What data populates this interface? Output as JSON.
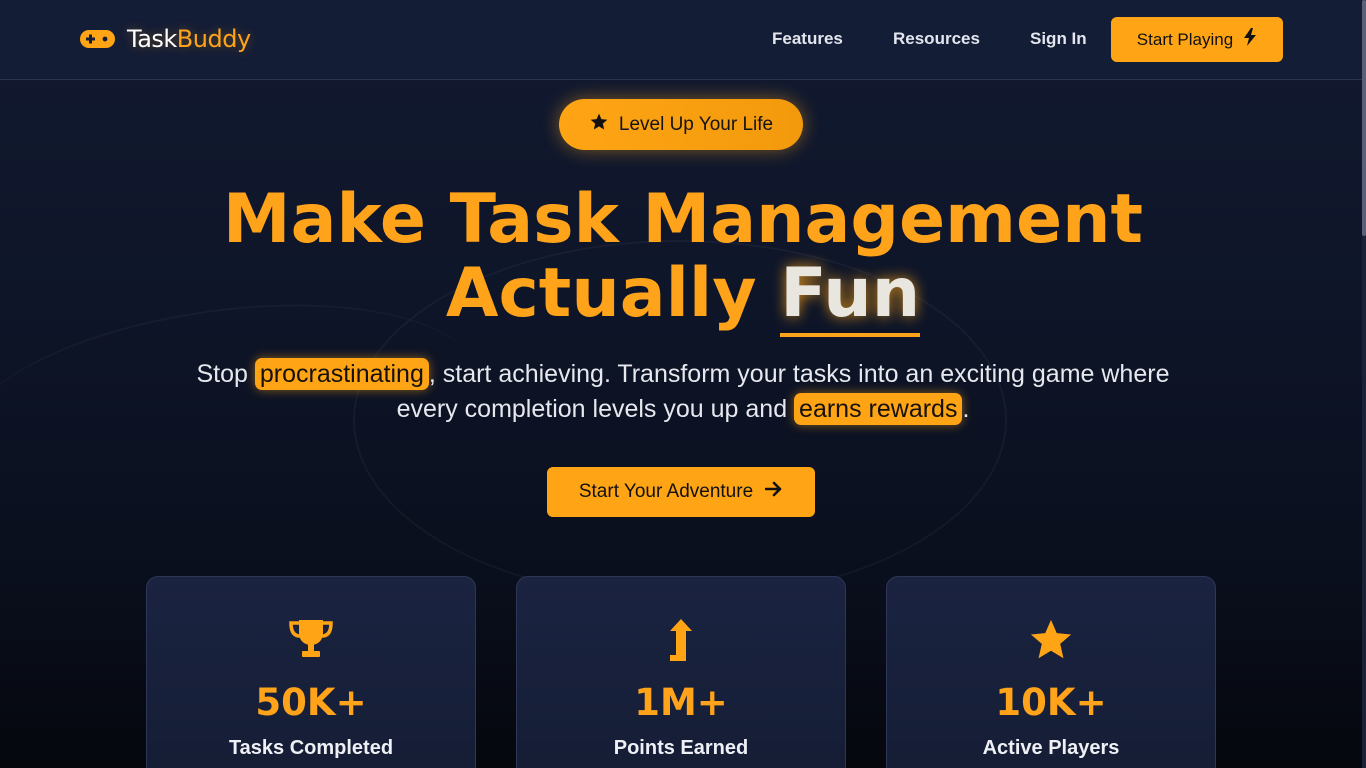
{
  "brand": {
    "name_part1": "Task",
    "name_part2": "Buddy",
    "accent": "#ffa515",
    "icon": "gamepad-icon"
  },
  "nav": {
    "links": [
      "Features",
      "Resources",
      "Sign In"
    ],
    "cta_label": "Start Playing",
    "cta_icon": "lightning-icon"
  },
  "hero": {
    "badge_label": "Level Up Your Life",
    "badge_icon": "star-icon",
    "headline_line1": "Make Task Management",
    "headline_line2_prefix": "Actually ",
    "headline_highlight": "Fun",
    "subtitle": {
      "p1": "Stop ",
      "hl1": "procrastinating",
      "p2": ", start achieving. Transform your tasks into an exciting game where",
      "p3": "every completion levels you up and ",
      "hl2": "earns rewards",
      "p4": "."
    },
    "cta_label": "Start Your Adventure",
    "cta_icon": "arrow-right-icon"
  },
  "stats": [
    {
      "value": "50K+",
      "label": "Tasks Completed",
      "icon": "trophy-icon"
    },
    {
      "value": "1M+",
      "label": "Points Earned",
      "icon": "arrow-up-icon"
    },
    {
      "value": "10K+",
      "label": "Active Players",
      "icon": "star-icon"
    }
  ]
}
